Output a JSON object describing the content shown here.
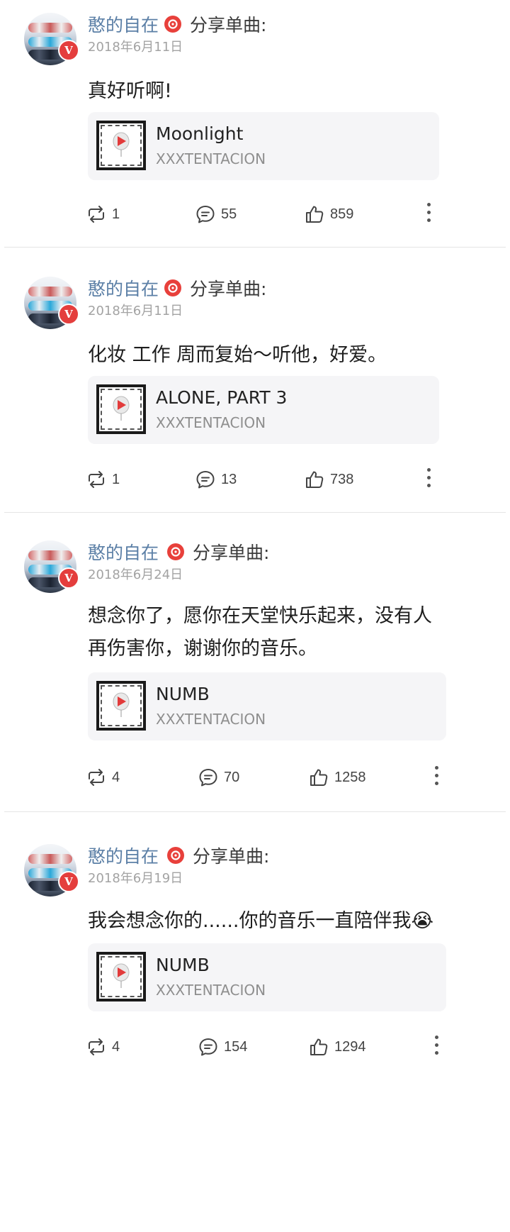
{
  "posts": [
    {
      "user_name": "憨的自在",
      "share_label": "分享单曲:",
      "date": "2018年6月11日",
      "text_lines": [
        "真好听啊!"
      ],
      "song_title": "Moonlight",
      "artist": "XXXTENTACION",
      "reposts": "1",
      "comments": "55",
      "likes": "859"
    },
    {
      "user_name": "憨的自在",
      "share_label": "分享单曲:",
      "date": "2018年6月11日",
      "text_lines": [
        "化妆 工作 周而复始～听他，好爱。"
      ],
      "song_title": "ALONE, PART 3",
      "artist": "XXXTENTACION",
      "reposts": "1",
      "comments": "13",
      "likes": "738"
    },
    {
      "user_name": "憨的自在",
      "share_label": "分享单曲:",
      "date": "2018年6月24日",
      "text_lines": [
        "想念你了，愿你在天堂快乐起来，没有人",
        "再伤害你，谢谢你的音乐。"
      ],
      "song_title": "NUMB",
      "artist": "XXXTENTACION",
      "reposts": "4",
      "comments": "70",
      "likes": "1258"
    },
    {
      "user_name": "憨的自在",
      "share_label": "分享单曲:",
      "date": "2018年6月19日",
      "text_lines": [
        "我会想念你的......你的音乐一直陪伴我😭"
      ],
      "song_title": "NUMB",
      "artist": "XXXTENTACION",
      "reposts": "4",
      "comments": "154",
      "likes": "1294"
    }
  ],
  "icons": {
    "verified_badge": "V",
    "repost": "repost-icon",
    "comment": "comment-icon",
    "like": "like-icon",
    "more": "more-icon",
    "music": "netease-music-icon"
  },
  "colors": {
    "user_name": "#5b7fa6",
    "verified": "#e43e3d",
    "netease_red": "#e8403b",
    "card_bg": "#f5f5f7"
  }
}
